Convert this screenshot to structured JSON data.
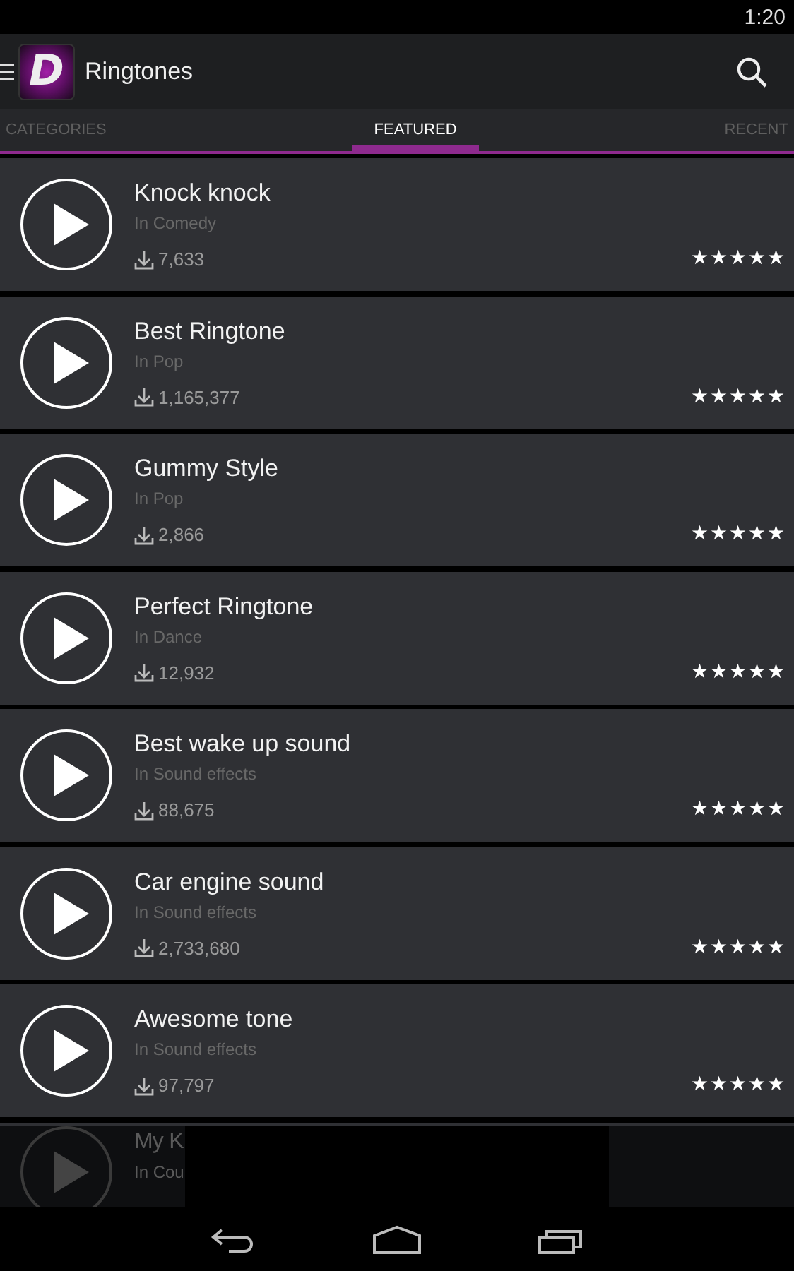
{
  "status_bar": {
    "time": "1:20"
  },
  "app_bar": {
    "logo_text": "D",
    "title": "Ringtones"
  },
  "tabs": [
    {
      "label": "CATEGORIES",
      "selected": false
    },
    {
      "label": "FEATURED",
      "selected": true
    },
    {
      "label": "RECENT",
      "selected": false
    }
  ],
  "ringtones": [
    {
      "kind": "full",
      "title": "Knock knock",
      "category": "In Comedy",
      "downloads": "7,633",
      "stars": 5
    },
    {
      "kind": "full",
      "title": "Best Ringtone",
      "category": "In Pop",
      "downloads": "1,165,377",
      "stars": 5
    },
    {
      "kind": "full",
      "title": "Gummy Style",
      "category": "In Pop",
      "downloads": "2,866",
      "stars": 5
    },
    {
      "kind": "full",
      "title": "Perfect Ringtone",
      "category": "In Dance",
      "downloads": "12,932",
      "stars": 5
    },
    {
      "kind": "full",
      "title": "Best wake up sound",
      "category": "In Sound effects",
      "downloads": "88,675",
      "stars": 5
    },
    {
      "kind": "full",
      "title": "Car engine sound",
      "category": "In Sound effects",
      "downloads": "2,733,680",
      "stars": 5
    },
    {
      "kind": "full",
      "title": "Awesome tone",
      "category": "In Sound effects",
      "downloads": "97,797",
      "stars": 5
    },
    {
      "kind": "partial",
      "title": "My K",
      "category": "In Cou"
    }
  ]
}
